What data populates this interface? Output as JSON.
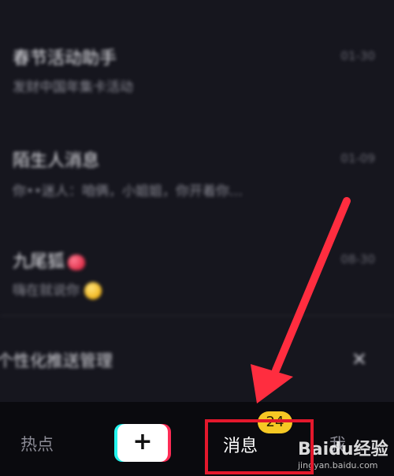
{
  "messages": [
    {
      "title": "春节活动助手",
      "subtitle": "发财中国年集卡活动",
      "time": "01-30",
      "emoji": ""
    },
    {
      "title": "陌生人消息",
      "subtitle": "你••迷人：咱俩，小姐姐，你开着你…",
      "time": "01-09",
      "emoji": ""
    },
    {
      "title": "九尾狐",
      "subtitle": "嗨在就说你",
      "time": "08-30",
      "emoji": "heart"
    }
  ],
  "banner": {
    "text": "个性化推送管理",
    "close_icon": "close-icon"
  },
  "tabbar": {
    "hot_label": "热点",
    "plus_label": "+",
    "messages_label": "消息",
    "messages_badge": "24",
    "me_label": "我"
  },
  "watermark": {
    "text": "Baidu经验",
    "url": "jingyan.baidu.com"
  },
  "annotation": {
    "color": "#ff2d3f",
    "box_color": "#e4182c"
  },
  "colors": {
    "background": "#16161e",
    "tabbar_bg": "#0a0a0e",
    "badge_bg": "#f6c824",
    "plus_cyan": "#25f4ee",
    "plus_red": "#fe2c55"
  }
}
